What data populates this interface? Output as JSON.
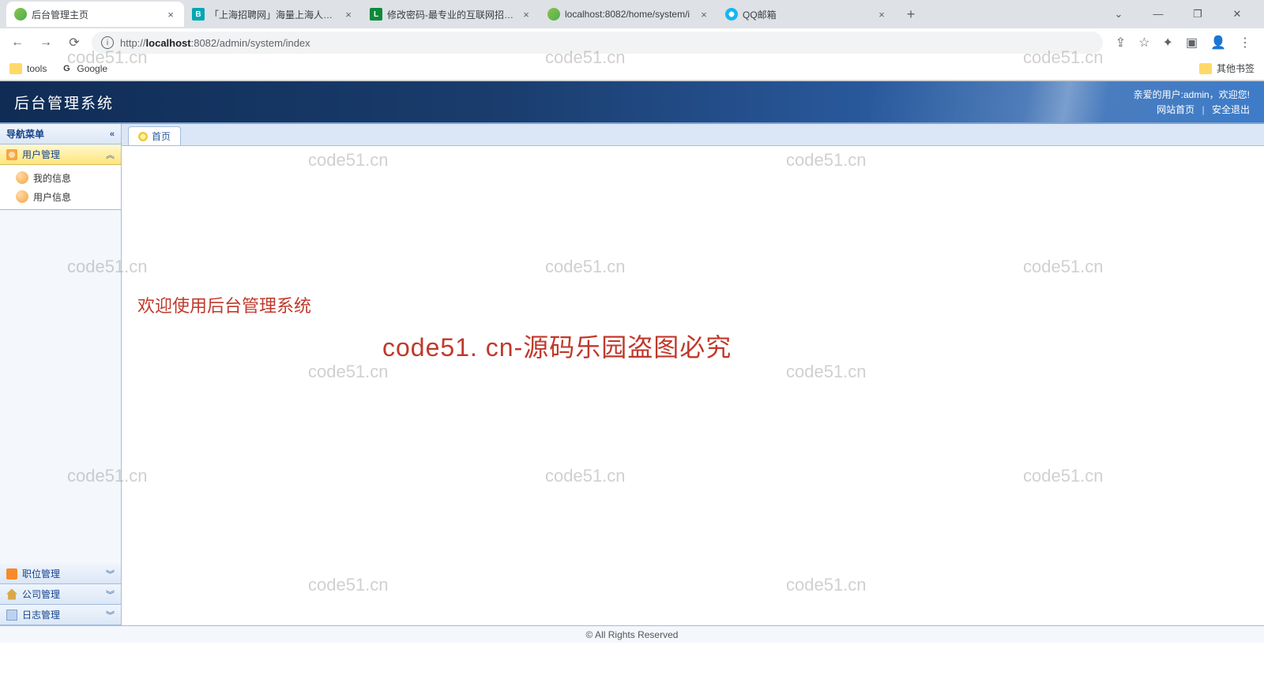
{
  "browser": {
    "tabs": [
      {
        "title": "后台管理主页"
      },
      {
        "title": "「上海招聘网」海量上海人才招"
      },
      {
        "title": "修改密码-最专业的互联网招聘平"
      },
      {
        "title": "localhost:8082/home/system/i"
      },
      {
        "title": "QQ邮箱"
      }
    ],
    "url": "http://localhost:8082/admin/system/index",
    "url_host": "localhost",
    "url_port": ":8082",
    "url_path": "/admin/system/index",
    "url_proto": "http://",
    "bookmarks": {
      "tools": "tools",
      "google": "Google",
      "other": "其他书签"
    }
  },
  "app": {
    "title": "后台管理系统",
    "user_line": "亲爱的用户:admin，欢迎您!",
    "link_site": "网站首页",
    "link_logout": "安全退出"
  },
  "sidebar": {
    "nav_title": "导航菜单",
    "groups": {
      "user": "用户管理",
      "position": "职位管理",
      "company": "公司管理",
      "log": "日志管理"
    },
    "items": {
      "my_info": "我的信息",
      "user_info": "用户信息"
    }
  },
  "main": {
    "tab_home": "首页",
    "welcome": "欢迎使用后台管理系统",
    "big_watermark": "code51. cn-源码乐园盗图必究"
  },
  "footer": {
    "copyright": "© All Rights Reserved"
  },
  "watermark": "code51.cn"
}
